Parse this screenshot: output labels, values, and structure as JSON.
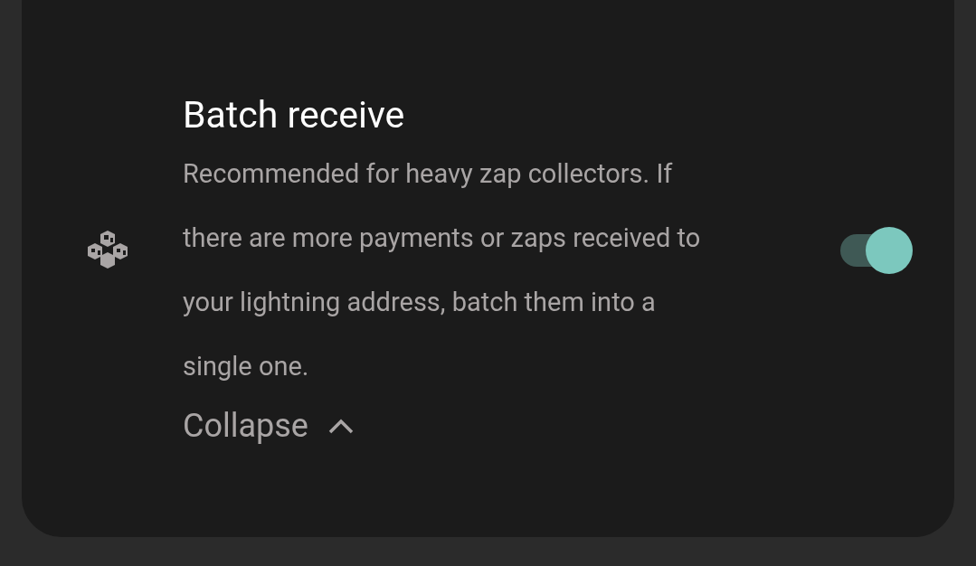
{
  "setting": {
    "title": "Batch receive",
    "description": "Recommended for heavy zap collectors. If there are more payments or zaps received to your lightning address, batch them into a single one.",
    "collapse_label": "Collapse",
    "expanded": true,
    "on": true
  }
}
